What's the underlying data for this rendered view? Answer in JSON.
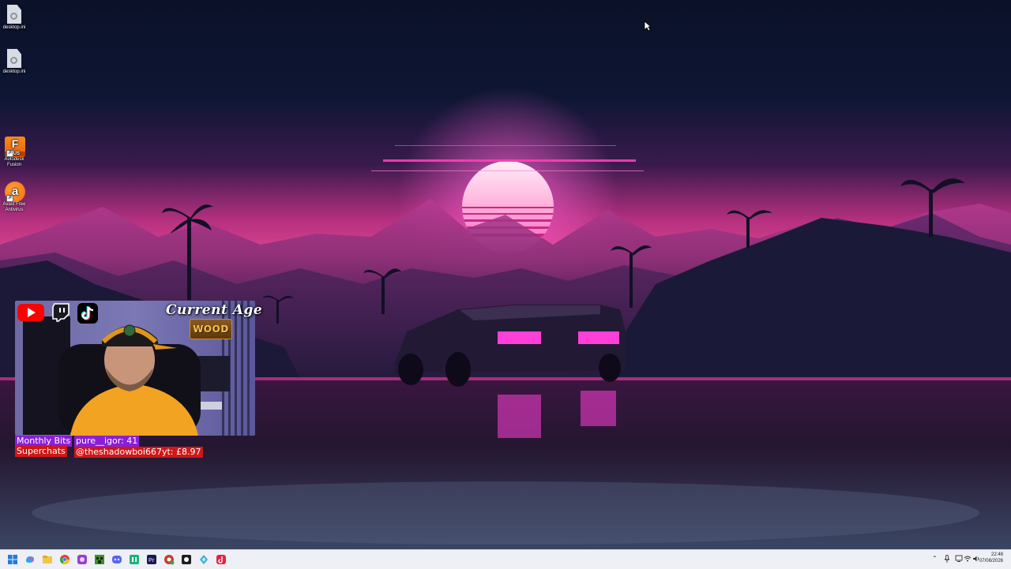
{
  "desktop": {
    "icons": [
      {
        "label": "desktop.ini",
        "icon": "settings-file-icon"
      },
      {
        "label": "desktop.ini",
        "icon": "settings-file-icon"
      },
      {
        "label": "Autodesk Fusion",
        "icon": "autodesk-fusion-icon",
        "glyph": "F",
        "glyph_sub": "FUS"
      },
      {
        "label": "Avast Free Antivirus",
        "icon": "avast-icon",
        "glyph": "a"
      }
    ]
  },
  "overlay": {
    "heading": "Current Age",
    "age_badge": "WOOD",
    "social_icons": [
      "youtube-icon",
      "twitch-icon",
      "tiktok-icon"
    ],
    "monthly_bits": {
      "label": "Monthly Bits",
      "value": "pure__igor: 41"
    },
    "superchats": {
      "label": "Superchats",
      "value": "@theshadowboi667yt: £8.97"
    }
  },
  "taskbar": {
    "apps": [
      "windows-start-icon",
      "copilot-icon",
      "file-explorer-icon",
      "chrome-icon",
      "app-purple-icon",
      "minecraft-icon",
      "discord-icon",
      "app-green-icon",
      "premiere-pro-icon",
      "chrome-profile-icon",
      "app-dark-icon",
      "app-blue-icon",
      "tiktok-icon"
    ],
    "tray": {
      "icons": [
        "chevron-up-icon",
        "microphone-icon",
        "wifi-icon",
        "network-icon",
        "volume-icon"
      ],
      "time": "22:48",
      "date": "07/08/2026"
    }
  },
  "colors": {
    "sky_top": "#0b1530",
    "sky_glow": "#d93a9c",
    "sun": "#ff4fc8",
    "bits_bg": "#8a1fd6",
    "superchats_bg": "#d01717",
    "taskbar_bg": "#eef0f5"
  }
}
